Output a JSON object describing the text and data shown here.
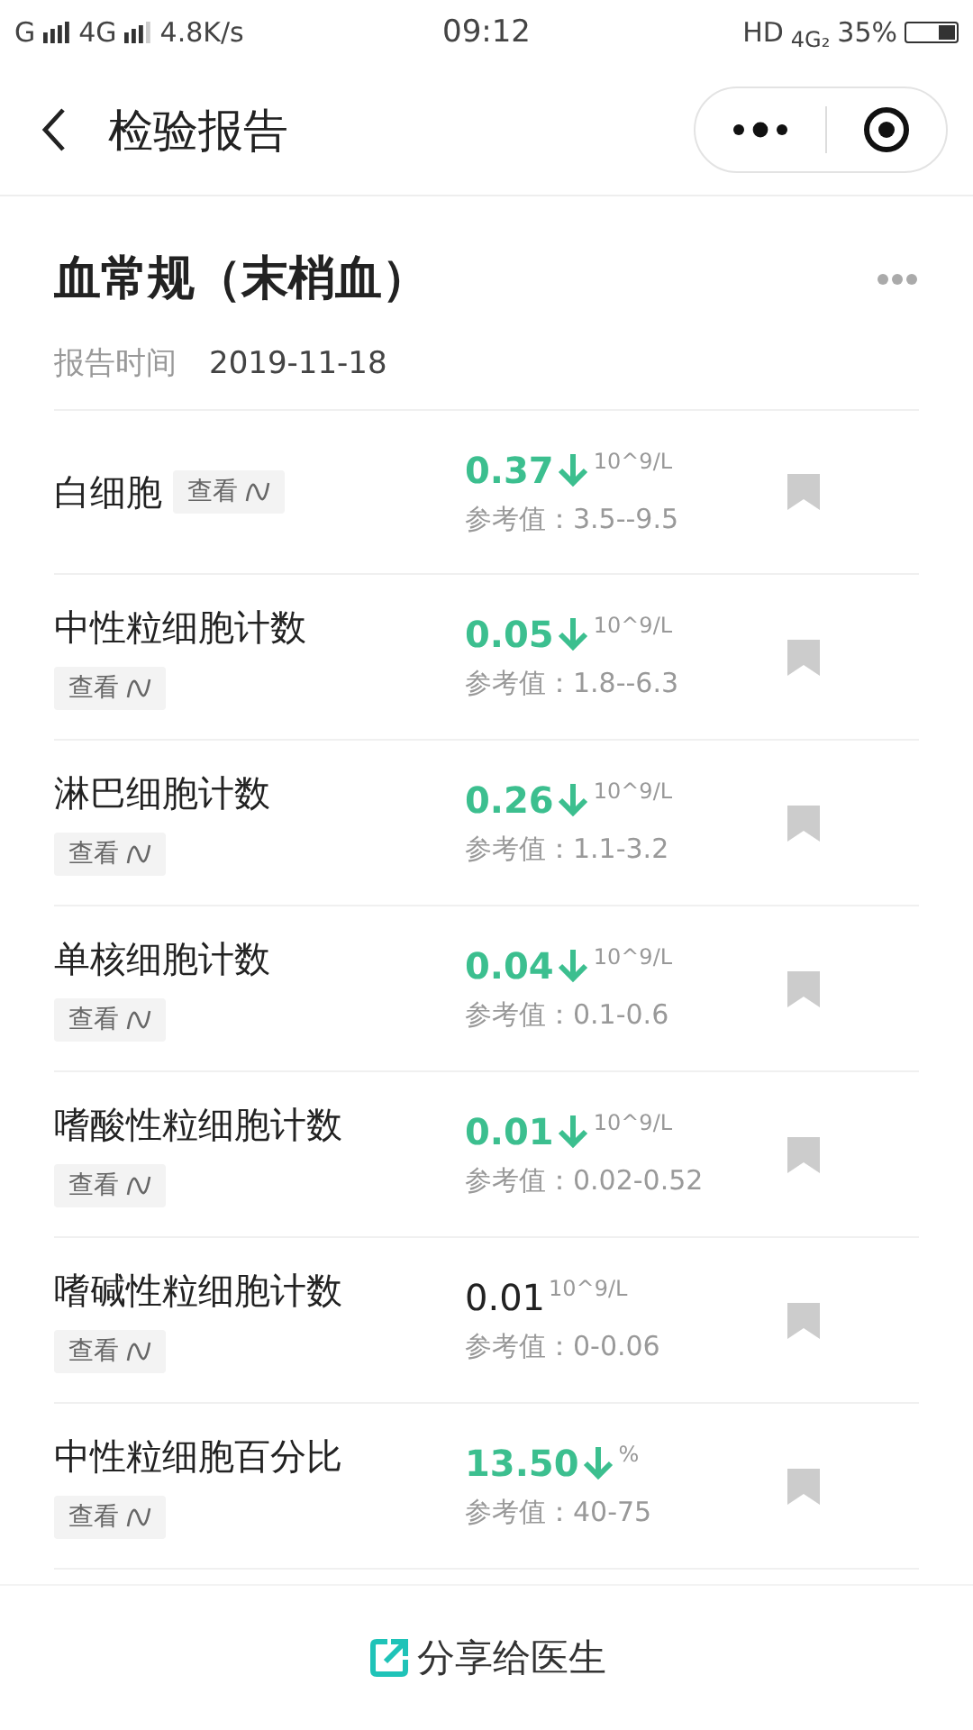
{
  "status_bar": {
    "carrier1": "G",
    "carrier2": "4G",
    "speed": "4.8K/s",
    "time": "09:12",
    "hd": "HD",
    "net": "4G₂",
    "battery": "35%"
  },
  "nav": {
    "title": "检验报告"
  },
  "report": {
    "title": "血常规（末梢血）",
    "time_label": "报告时间",
    "time": "2019-11-18"
  },
  "items": [
    {
      "name": "白细胞",
      "kind": "inline",
      "view": "查看",
      "value": "0.37",
      "low": true,
      "unit": "10^9/L",
      "reference": "参考值：3.5--9.5"
    },
    {
      "name": "中性粒细胞计数",
      "kind": "stacked",
      "view": "查看",
      "value": "0.05",
      "low": true,
      "unit": "10^9/L",
      "reference": "参考值：1.8--6.3"
    },
    {
      "name": "淋巴细胞计数",
      "kind": "stacked",
      "view": "查看",
      "value": "0.26",
      "low": true,
      "unit": "10^9/L",
      "reference": "参考值：1.1-3.2"
    },
    {
      "name": "单核细胞计数",
      "kind": "stacked",
      "view": "查看",
      "value": "0.04",
      "low": true,
      "unit": "10^9/L",
      "reference": "参考值：0.1-0.6"
    },
    {
      "name": "嗜酸性粒细胞计数",
      "kind": "stacked",
      "view": "查看",
      "value": "0.01",
      "low": true,
      "unit": "10^9/L",
      "reference": "参考值：0.02-0.52"
    },
    {
      "name": "嗜碱性粒细胞计数",
      "kind": "stacked",
      "view": "查看",
      "value": "0.01",
      "low": false,
      "unit": "10^9/L",
      "reference": "参考值：0-0.06"
    },
    {
      "name": "中性粒细胞百分比",
      "kind": "stacked",
      "view": "查看",
      "value": "13.50",
      "low": true,
      "unit": "%",
      "reference": "参考值：40-75"
    }
  ],
  "footer": {
    "share": "分享给医生"
  }
}
